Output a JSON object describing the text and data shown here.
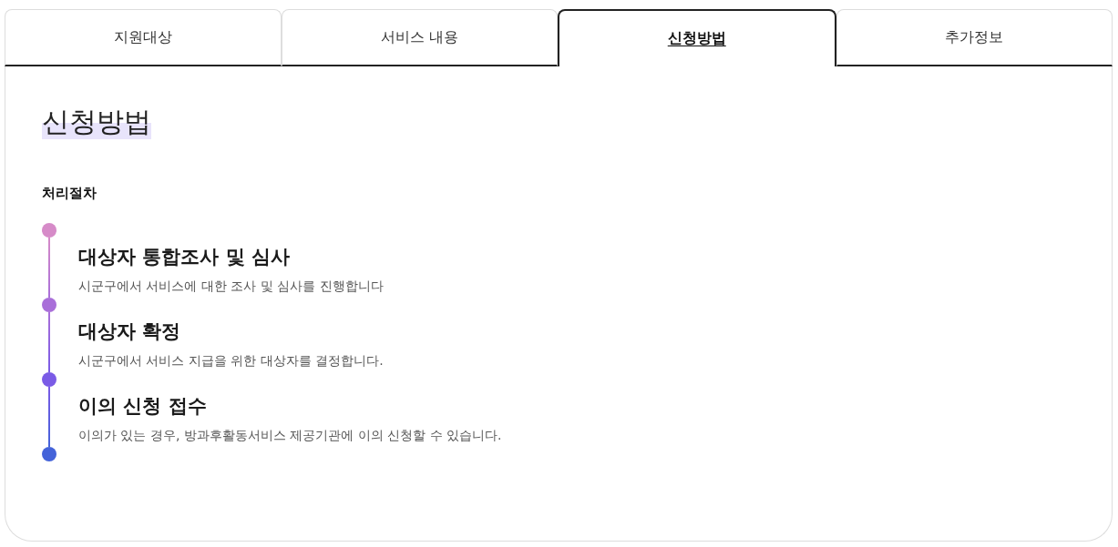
{
  "tabs": [
    {
      "label": "지원대상",
      "selected": false
    },
    {
      "label": "서비스 내용",
      "selected": false
    },
    {
      "label": "신청방법",
      "selected": true
    },
    {
      "label": "추가정보",
      "selected": false
    }
  ],
  "section": {
    "title": "신청방법",
    "subtitle": "처리절차"
  },
  "timeline": {
    "steps": [
      {
        "title": "대상자 통합조사 및 심사",
        "description": "시군구에서 서비스에 대한 조사 및 심사를 진행합니다",
        "color": "#d68bc8"
      },
      {
        "title": "대상자 확정",
        "description": "시군구에서 서비스 지급을 위한 대상자를 결정합니다.",
        "color": "#a96fd9"
      },
      {
        "title": "이의 신청 접수",
        "description": "이의가 있는 경우, 방과후활동서비스 제공기관에 이의 신청할 수 있습니다.",
        "color": "#7a5be6"
      }
    ],
    "end_marker": {
      "color": "#4463d9"
    }
  }
}
